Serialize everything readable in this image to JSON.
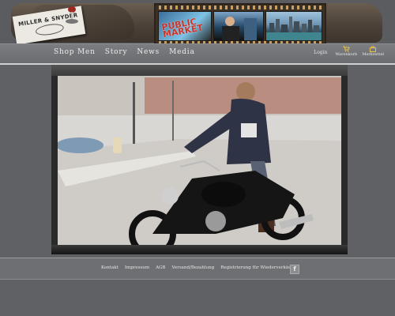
{
  "brand": {
    "logo_text": "MILLER & SNYDER",
    "logo_sub": "",
    "logo_icon": "logo-seal"
  },
  "header": {
    "film_frames": [
      {
        "sign": "PUBLIC MARKET"
      },
      {
        "sign": ""
      },
      {
        "sign": ""
      }
    ]
  },
  "nav": {
    "items": [
      "Shop Men",
      "Story",
      "News",
      "Media"
    ],
    "login_label": "Login",
    "cart": {
      "icon": "cart-icon",
      "label": "Warenkorb"
    },
    "wishlist": {
      "icon": "bag-icon",
      "label": "Merkzettel"
    }
  },
  "footer": {
    "links": [
      "Kontakt",
      "Impressum",
      "AGB",
      "Versand/Bezahlung",
      "Registrierung für Wiederverkäufer"
    ],
    "social": {
      "icon": "facebook-icon",
      "label": "f"
    }
  },
  "colors": {
    "page_bg": "#5f6164",
    "nav_text": "#ececec",
    "accent_red": "#9c2a21"
  }
}
